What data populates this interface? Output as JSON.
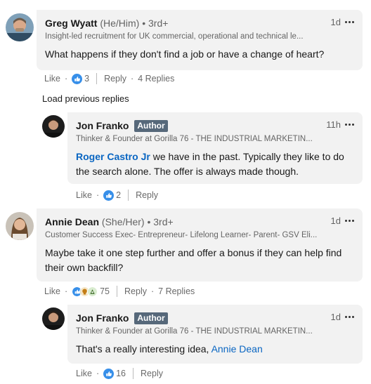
{
  "comments": [
    {
      "name": "Greg Wyatt",
      "pronoun": "(He/Him)",
      "degree": "• 3rd+",
      "headline": "Insight-led recruitment for UK commercial, operational and technical le...",
      "time": "1d",
      "text": "What happens if they don't find a job or have a change of heart?",
      "like_label": "Like",
      "reaction_count": "3",
      "reply_label": "Reply",
      "replies_label": "4 Replies"
    },
    {
      "name": "Jon Franko",
      "badge": "Author",
      "headline": "Thinker & Founder at Gorilla 76 - THE INDUSTRIAL MARKETIN...",
      "time": "11h",
      "mention": "Roger Castro Jr",
      "text": " we have in the past. Typically they like to do the search alone. The offer is always made though.",
      "like_label": "Like",
      "reaction_count": "2",
      "reply_label": "Reply"
    },
    {
      "name": "Annie Dean",
      "pronoun": "(She/Her)",
      "degree": "• 3rd+",
      "headline": "Customer Success Exec- Entrepreneur- Lifelong Learner- Parent- GSV Eli...",
      "time": "1d",
      "text": "Maybe take it one step further and offer a bonus if they can help find their own backfill?",
      "like_label": "Like",
      "reaction_count": "75",
      "reply_label": "Reply",
      "replies_label": "7 Replies"
    },
    {
      "name": "Jon Franko",
      "badge": "Author",
      "headline": "Thinker & Founder at Gorilla 76 - THE INDUSTRIAL MARKETIN...",
      "time": "1d",
      "text": "That's a really interesting idea, ",
      "mention": "Annie Dean",
      "like_label": "Like",
      "reaction_count": "16",
      "reply_label": "Reply"
    }
  ],
  "load_previous": "Load previous replies",
  "colors": {
    "link": "#0a66c2",
    "bubble": "#f2f2f2",
    "badge": "#56687a",
    "like": "#378fe9",
    "celebrate": "#44712e",
    "support": "#c37d16"
  },
  "icons": [
    "like-reaction-icon",
    "celebrate-reaction-icon",
    "support-reaction-icon",
    "more-options-icon"
  ]
}
